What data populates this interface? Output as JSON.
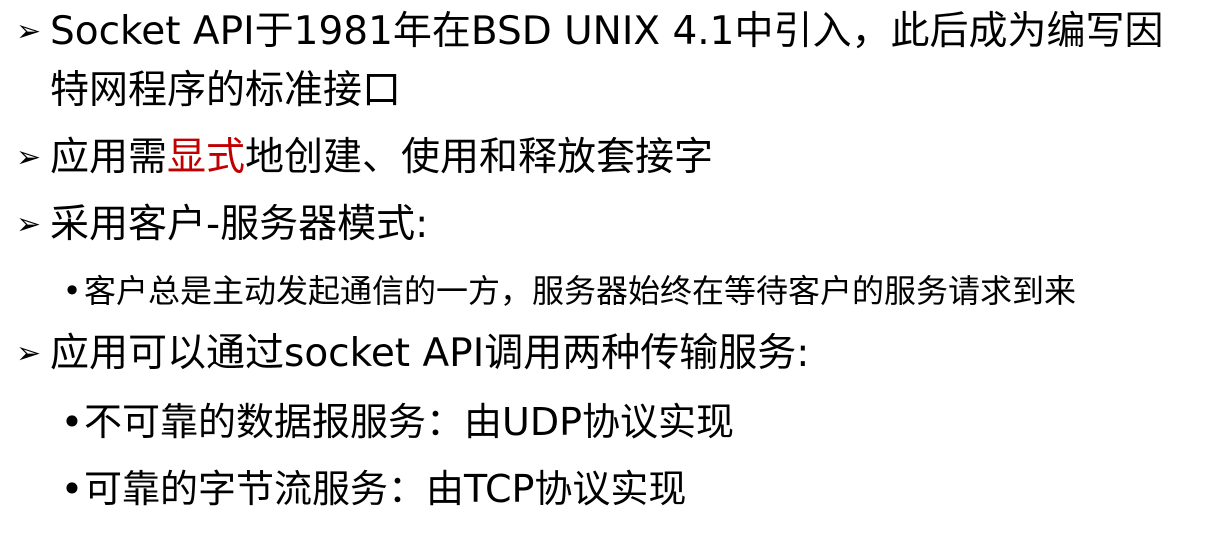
{
  "bullet_arrow": "➢",
  "bullet_dot": "•",
  "items": [
    {
      "line1": "Socket API于1981年在BSD UNIX 4.1中引入，此后成为编写因",
      "line2": "特网程序的标准接口"
    },
    {
      "before": "应用需",
      "highlight": "显式",
      "after": "地创建、使用和释放套接字",
      "highlight_color": "#c00000"
    },
    {
      "text": "采用客户-服务器模式:",
      "sub": [
        "客户总是主动发起通信的一方，服务器始终在等待客户的服务请求到来"
      ]
    },
    {
      "text": "应用可以通过socket API调用两种传输服务:",
      "sub": [
        "不可靠的数据报服务：由UDP协议实现",
        "可靠的字节流服务：由TCP协议实现"
      ]
    }
  ]
}
